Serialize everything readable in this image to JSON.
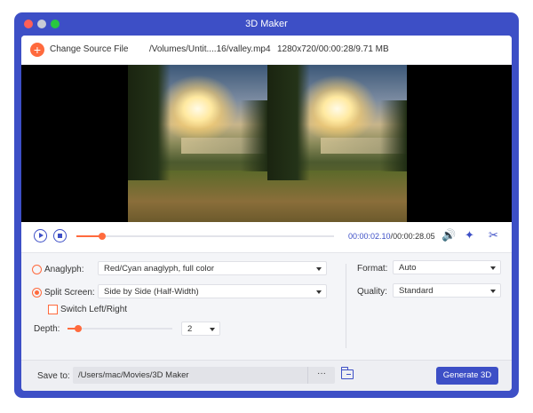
{
  "window": {
    "title": "3D Maker"
  },
  "source": {
    "change_label": "Change Source File",
    "path": "/Volumes/Untit....16/valley.mp4",
    "meta": "1280x720/00:00:28/9.71 MB"
  },
  "playback": {
    "current_time": "00:00:02.10",
    "separator": "/",
    "total_time": "00:00:28.05",
    "progress": 0.1
  },
  "settings": {
    "anaglyph": {
      "label": "Anaglyph:",
      "value": "Red/Cyan anaglyph, full color",
      "selected": false
    },
    "split": {
      "label": "Split Screen:",
      "value": "Side by Side (Half-Width)",
      "selected": true
    },
    "switch_lr": {
      "label": "Switch Left/Right",
      "checked": false
    },
    "depth": {
      "label": "Depth:",
      "value": "2",
      "level": 0.1
    },
    "format": {
      "label": "Format:",
      "value": "Auto"
    },
    "quality": {
      "label": "Quality:",
      "value": "Standard"
    }
  },
  "footer": {
    "save_label": "Save to:",
    "save_path": "/Users/mac/Movies/3D Maker",
    "browse_label": "···",
    "generate_label": "Generate 3D"
  },
  "colors": {
    "accent": "#3d4fc6",
    "orange": "#ff6a3d"
  },
  "icons": [
    "plus-icon",
    "play-icon",
    "stop-icon",
    "volume-icon",
    "effects-icon",
    "cut-icon",
    "folder-icon"
  ]
}
